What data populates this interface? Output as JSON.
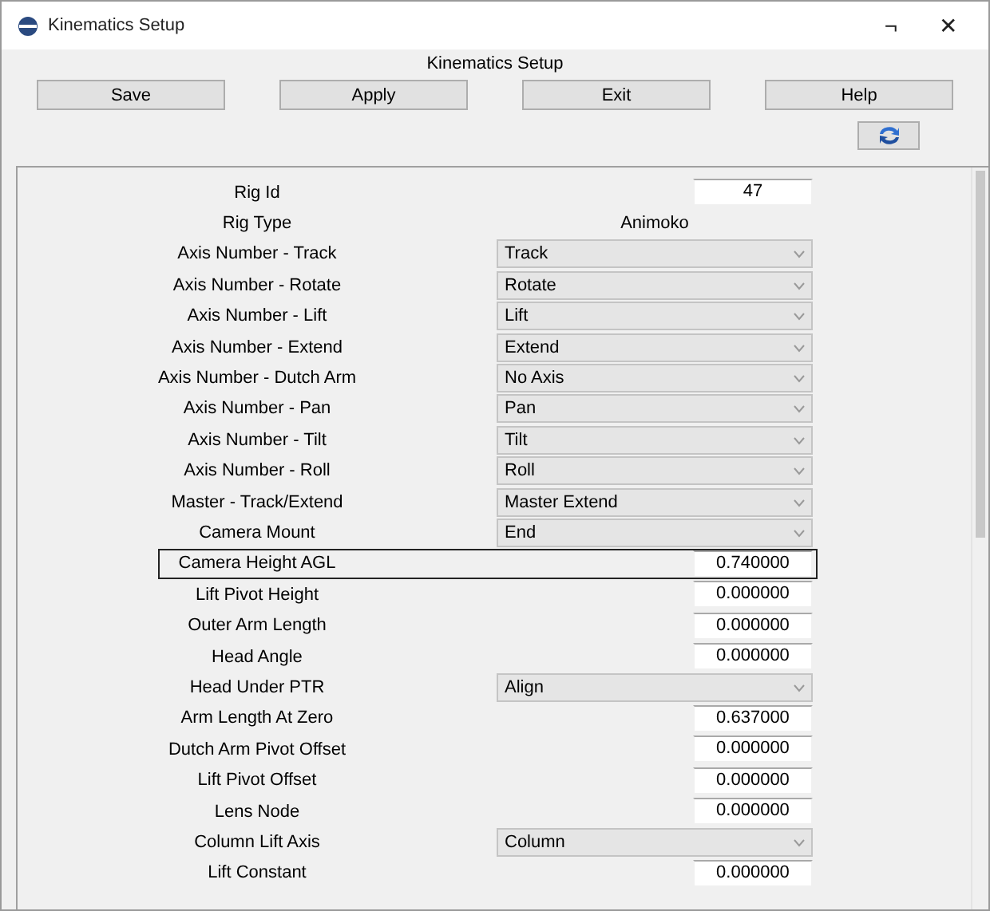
{
  "window": {
    "title": "Kinematics Setup",
    "maximize_icon": "¬",
    "close_icon": "✕"
  },
  "heading": "Kinematics Setup",
  "buttons": [
    "Save",
    "Apply",
    "Exit",
    "Help"
  ],
  "rows": [
    {
      "kind": "field",
      "label": "Rig Id",
      "value": "47",
      "focused": false
    },
    {
      "kind": "text",
      "label": "Rig Type",
      "value": "Animoko"
    },
    {
      "kind": "dropdown",
      "label": "Axis Number - Track",
      "value": "Track"
    },
    {
      "kind": "dropdown",
      "label": "Axis Number - Rotate",
      "value": "Rotate"
    },
    {
      "kind": "dropdown",
      "label": "Axis Number - Lift",
      "value": "Lift"
    },
    {
      "kind": "dropdown",
      "label": "Axis Number - Extend",
      "value": "Extend"
    },
    {
      "kind": "dropdown",
      "label": "Axis Number - Dutch Arm",
      "value": "No Axis"
    },
    {
      "kind": "dropdown",
      "label": "Axis Number - Pan",
      "value": "Pan"
    },
    {
      "kind": "dropdown",
      "label": "Axis Number - Tilt",
      "value": "Tilt"
    },
    {
      "kind": "dropdown",
      "label": "Axis Number - Roll",
      "value": "Roll"
    },
    {
      "kind": "dropdown",
      "label": "Master - Track/Extend",
      "value": "Master Extend"
    },
    {
      "kind": "dropdown",
      "label": "Camera Mount",
      "value": "End"
    },
    {
      "kind": "field",
      "label": "Camera Height AGL",
      "value": "0.740000",
      "focused": true
    },
    {
      "kind": "field",
      "label": "Lift Pivot Height",
      "value": "0.000000",
      "focused": false
    },
    {
      "kind": "field",
      "label": "Outer Arm Length",
      "value": "0.000000",
      "focused": false
    },
    {
      "kind": "field",
      "label": "Head Angle",
      "value": "0.000000",
      "focused": false
    },
    {
      "kind": "dropdown",
      "label": "Head Under PTR",
      "value": "Align"
    },
    {
      "kind": "field",
      "label": "Arm Length At Zero",
      "value": "0.637000",
      "focused": false
    },
    {
      "kind": "field",
      "label": "Dutch Arm Pivot Offset",
      "value": "0.000000",
      "focused": false
    },
    {
      "kind": "field",
      "label": "Lift Pivot Offset",
      "value": "0.000000",
      "focused": false
    },
    {
      "kind": "field",
      "label": "Lens Node",
      "value": "0.000000",
      "focused": false
    },
    {
      "kind": "dropdown",
      "label": "Column Lift Axis",
      "value": "Column"
    },
    {
      "kind": "field",
      "label": "Lift Constant",
      "value": "0.000000",
      "focused": false
    }
  ]
}
